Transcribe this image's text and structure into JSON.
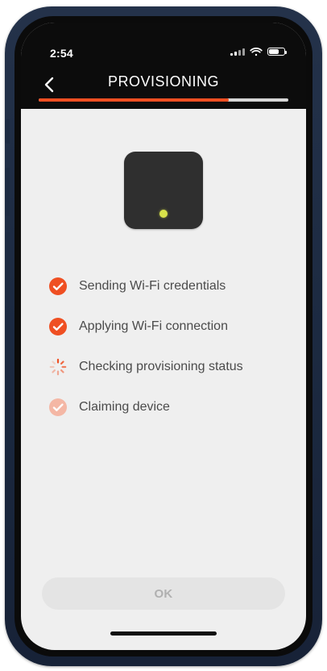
{
  "status_bar": {
    "time": "2:54",
    "signal_icon": "signal-icon",
    "wifi_icon": "wifi-icon",
    "battery_icon": "battery-icon"
  },
  "header": {
    "title": "PROVISIONING",
    "back_icon": "chevron-left-icon"
  },
  "progress": {
    "percent": 76
  },
  "device": {
    "icon": "device-icon",
    "led_icon": "status-led-icon",
    "led_color": "#d9e34a",
    "body_color": "#2f2f2f"
  },
  "steps": [
    {
      "label": "Sending Wi-Fi credentials",
      "state": "done",
      "icon": "check-circle-icon"
    },
    {
      "label": "Applying Wi-Fi connection",
      "state": "done",
      "icon": "check-circle-icon"
    },
    {
      "label": "Checking provisioning status",
      "state": "in_progress",
      "icon": "spinner-icon"
    },
    {
      "label": "Claiming device",
      "state": "pending",
      "icon": "check-circle-faded-icon"
    }
  ],
  "footer": {
    "ok_label": "OK"
  },
  "colors": {
    "accent": "#ef4f22",
    "accent_faded": "#f4b7a5",
    "screen_bg": "#efefef",
    "header_bg": "#0c0c0c"
  }
}
